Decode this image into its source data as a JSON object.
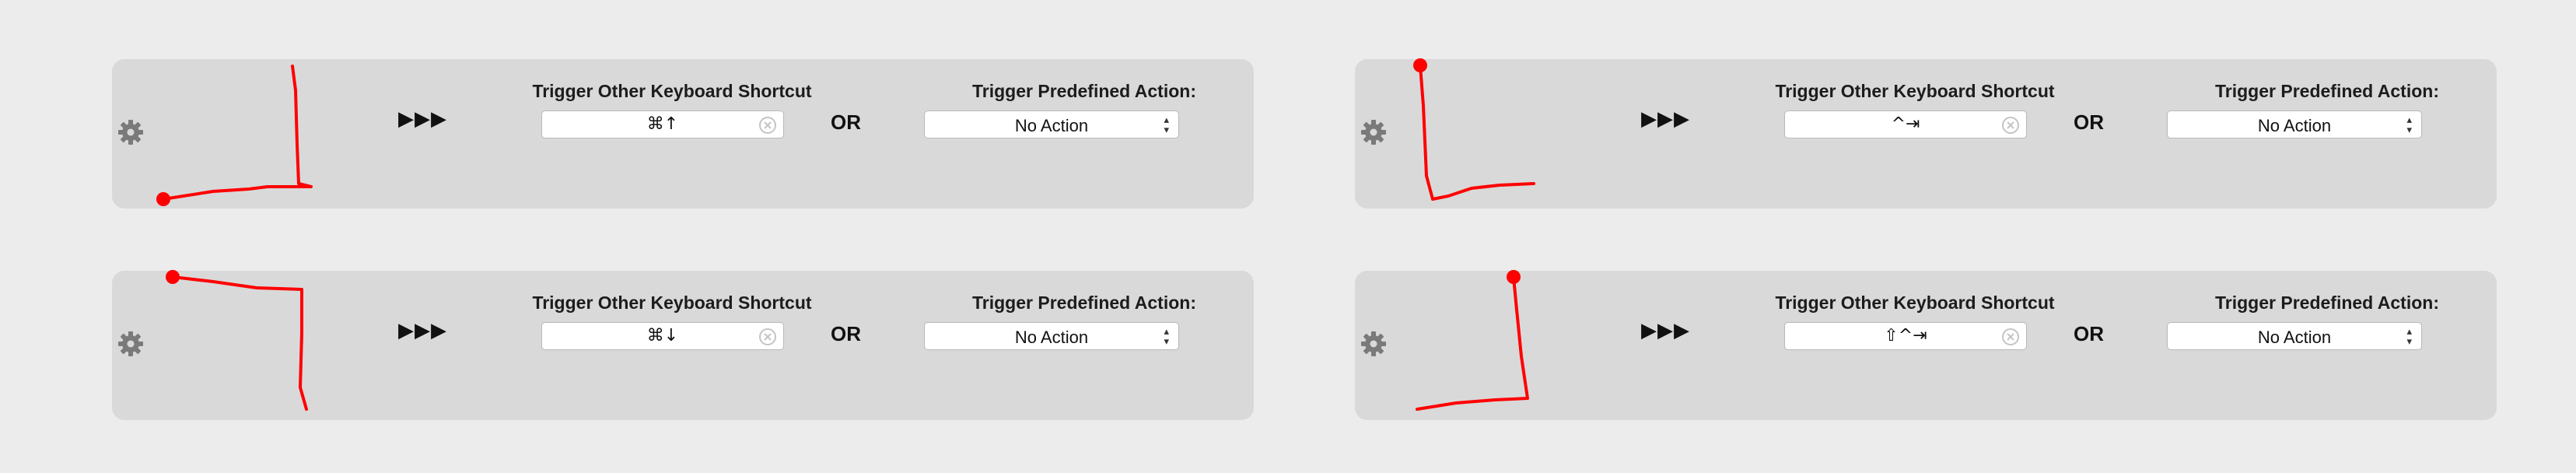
{
  "colors": {
    "background": "#ececec",
    "panel": "#d9d9d9",
    "gesture_stroke": "#ff0000",
    "gear": "#7a7a7a"
  },
  "icons": {
    "settings": "gear-icon",
    "clear": "clear-circle-icon",
    "stepper": "up-down-chevron-icon",
    "play_arrows": "triple-play-arrow-icon"
  },
  "rows": [
    {
      "arrows": "▶▶▶",
      "shortcut_label": "Trigger Other Keyboard Shortcut",
      "shortcut_value": "⌘↑",
      "or_text": "OR",
      "action_label": "Trigger Predefined Action:",
      "action_value": "No Action"
    },
    {
      "arrows": "▶▶▶",
      "shortcut_label": "Trigger Other Keyboard Shortcut",
      "shortcut_value": "^⇥",
      "or_text": "OR",
      "action_label": "Trigger Predefined Action:",
      "action_value": "No Action"
    },
    {
      "arrows": "▶▶▶",
      "shortcut_label": "Trigger Other Keyboard Shortcut",
      "shortcut_value": "⌘↓",
      "or_text": "OR",
      "action_label": "Trigger Predefined Action:",
      "action_value": "No Action"
    },
    {
      "arrows": "▶▶▶",
      "shortcut_label": "Trigger Other Keyboard Shortcut",
      "shortcut_value": "⇧^⇥",
      "or_text": "OR",
      "action_label": "Trigger Predefined Action:",
      "action_value": "No Action"
    }
  ]
}
